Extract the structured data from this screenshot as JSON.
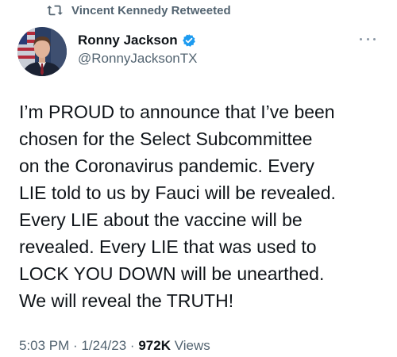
{
  "retweet": {
    "text": "Vincent Kennedy Retweeted"
  },
  "author": {
    "display_name": "Ronny Jackson",
    "handle": "@RonnyJacksonTX",
    "verified": true
  },
  "tweet": {
    "text": "I’m PROUD to announce that I’ve been\nchosen for the Select Subcommittee\non the Coronavirus pandemic. Every\nLIE told to us by Fauci will be revealed.\nEvery LIE about the vaccine will be\nrevealed. Every LIE that was used to\nLOCK YOU DOWN will be unearthed.\nWe will reveal the TRUTH!"
  },
  "meta": {
    "time": "5:03 PM",
    "separator": "·",
    "date": "1/24/23",
    "views_count": "972K",
    "views_label": "Views"
  },
  "colors": {
    "text_primary": "#0f1419",
    "text_secondary": "#536471",
    "verified_blue": "#1d9bf0"
  },
  "icons": {
    "retweet": "retweet-icon",
    "verified": "verified-badge-icon",
    "more": "more-options-icon"
  }
}
